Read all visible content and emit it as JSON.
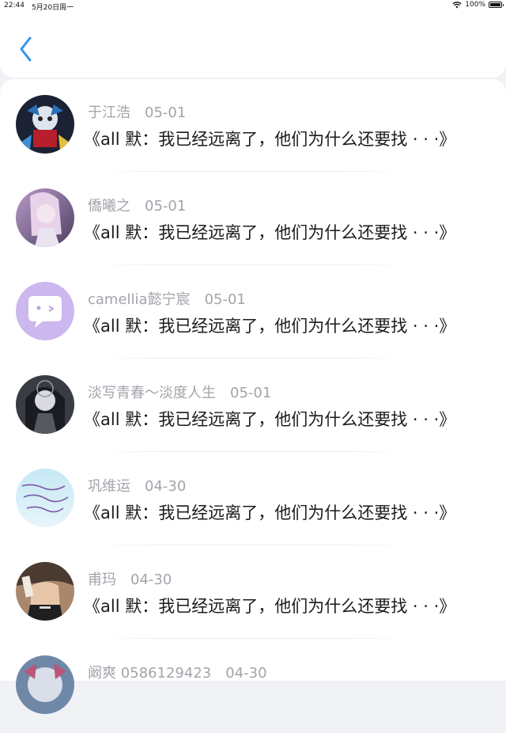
{
  "status_bar": {
    "time": "22:44",
    "date": "5月20日周一",
    "battery": "100%",
    "icons": [
      "wifi-icon",
      "battery-icon"
    ]
  },
  "nav": {
    "back_icon": "chevron-left-icon",
    "accent_color": "#2f95f2"
  },
  "items": [
    {
      "name": "于江浩",
      "date": "05-01",
      "title": "《all 默：我已经远离了，他们为什么还要找 · · ·》"
    },
    {
      "name": "僑曦之",
      "date": "05-01",
      "title": "《all 默：我已经远离了，他们为什么还要找 · · ·》"
    },
    {
      "name": "camellia懿宁宸",
      "date": "05-01",
      "title": "《all 默：我已经远离了，他们为什么还要找 · · ·》"
    },
    {
      "name": "淡写青春～淡度人生",
      "date": "05-01",
      "title": "《all 默：我已经远离了，他们为什么还要找 · · ·》"
    },
    {
      "name": "巩维运",
      "date": "04-30",
      "title": "《all 默：我已经远离了，他们为什么还要找 · · ·》"
    },
    {
      "name": "甫玛",
      "date": "04-30",
      "title": "《all 默：我已经远离了，他们为什么还要找 · · ·》"
    },
    {
      "name": "阚爽 0586129423",
      "date": "04-30",
      "title": ""
    }
  ]
}
